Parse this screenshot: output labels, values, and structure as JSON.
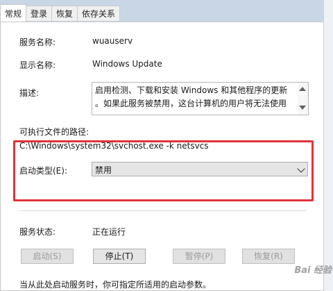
{
  "tabs": [
    {
      "label": "常规",
      "active": true
    },
    {
      "label": "登录",
      "active": false
    },
    {
      "label": "恢复",
      "active": false
    },
    {
      "label": "依存关系",
      "active": false
    }
  ],
  "service_name": {
    "label": "服务名称:",
    "value": "wuauserv"
  },
  "display_name": {
    "label": "显示名称:",
    "value": "Windows Update"
  },
  "description": {
    "label": "描述:",
    "lines": [
      "启用检测、下载和安装 Windows 和其他程序的更新",
      "。如果此服务被禁用，这台计算机的用户将无法使用"
    ]
  },
  "exec_path": {
    "label": "可执行文件的路径:",
    "value": "C:\\Windows\\system32\\svchost.exe -k netsvcs"
  },
  "startup_type": {
    "label": "启动类型(E):",
    "value": "禁用"
  },
  "service_status": {
    "label": "服务状态:",
    "value": "正在运行"
  },
  "buttons": {
    "start": "启动(S)",
    "stop": "停止(T)",
    "pause": "暂停(P)",
    "resume": "恢复(R)"
  },
  "footer_text": "当从此处启动服务时，你可指定所适用的启动参数。",
  "watermark": "Bai 经验",
  "colors": {
    "highlight": "#e1333a",
    "panel": "#ffffff",
    "background": "#c9d6e6"
  }
}
